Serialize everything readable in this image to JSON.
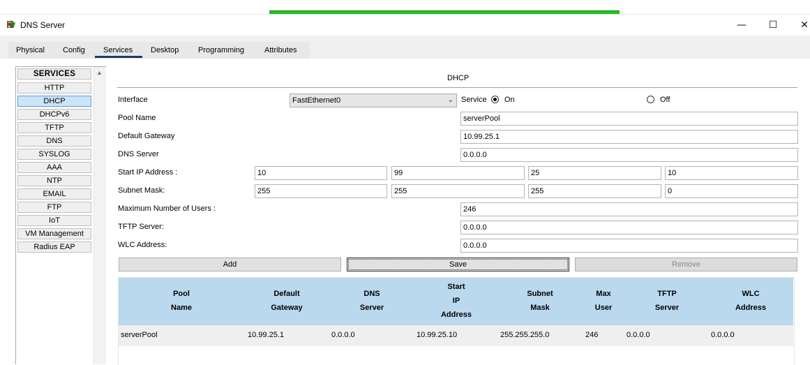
{
  "window": {
    "title": "DNS Server",
    "controls": {
      "minimize": "—",
      "maximize": "☐",
      "close": "✕"
    }
  },
  "tabs": [
    {
      "label": "Physical"
    },
    {
      "label": "Config"
    },
    {
      "label": "Services",
      "active": true
    },
    {
      "label": "Desktop"
    },
    {
      "label": "Programming"
    },
    {
      "label": "Attributes"
    }
  ],
  "sidebar": {
    "header": "SERVICES",
    "items": [
      "HTTP",
      "DHCP",
      "DHCPv6",
      "TFTP",
      "DNS",
      "SYSLOG",
      "AAA",
      "NTP",
      "EMAIL",
      "FTP",
      "IoT",
      "VM Management",
      "Radius EAP"
    ],
    "selected": "DHCP"
  },
  "dhcp": {
    "section_title": "DHCP",
    "interface_label": "Interface",
    "interface_value": "FastEthernet0",
    "service_label": "Service",
    "on_label": "On",
    "off_label": "Off",
    "service_state": "On",
    "pool_name_label": "Pool Name",
    "pool_name": "serverPool",
    "gateway_label": "Default Gateway",
    "gateway": "10.99.25.1",
    "dns_label": "DNS Server",
    "dns": "0.0.0.0",
    "start_ip_label": "Start IP Address :",
    "start_ip": [
      "10",
      "99",
      "25",
      "10"
    ],
    "subnet_label": "Subnet Mask:",
    "subnet": [
      "255",
      "255",
      "255",
      "0"
    ],
    "max_users_label": "Maximum Number of Users :",
    "max_users": "246",
    "tftp_label": "TFTP Server:",
    "tftp": "0.0.0.0",
    "wlc_label": "WLC Address:",
    "wlc": "0.0.0.0"
  },
  "buttons": {
    "add": "Add",
    "save": "Save",
    "remove": "Remove"
  },
  "table": {
    "headers": [
      [
        "Pool",
        "Name"
      ],
      [
        "Default",
        "Gateway"
      ],
      [
        "DNS",
        "Server"
      ],
      [
        "Start",
        "IP",
        "Address"
      ],
      [
        "Subnet",
        "Mask"
      ],
      [
        "Max",
        "User"
      ],
      [
        "TFTP",
        "Server"
      ],
      [
        "WLC",
        "Address"
      ]
    ],
    "rows": [
      [
        "serverPool",
        "10.99.25.1",
        "0.0.0.0",
        "10.99.25.10",
        "255.255.255.0",
        "246",
        "0.0.0.0",
        "0.0.0.0"
      ]
    ]
  },
  "colors": {
    "accent_tab_underline": "#1a3c63",
    "selected_item": "#cce4f7",
    "table_header": "#bad8ee",
    "progress": "#1ec51e"
  }
}
